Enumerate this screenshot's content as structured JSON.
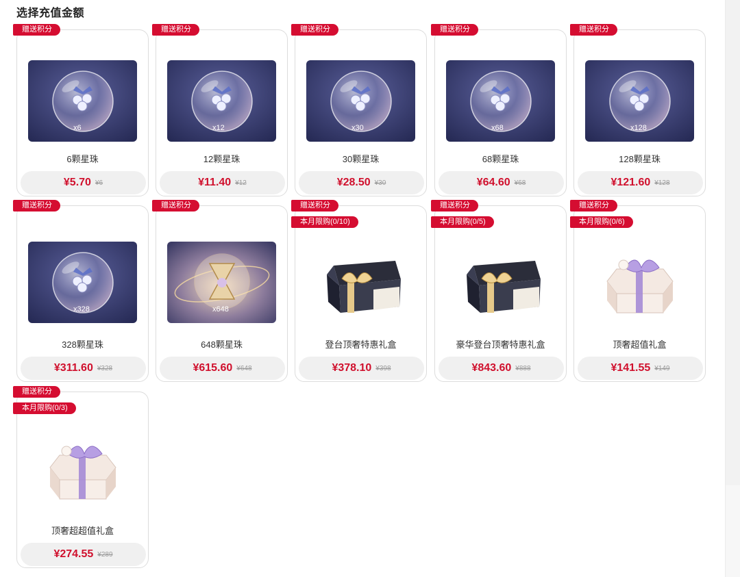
{
  "header": {
    "title": "选择充值金额"
  },
  "colors": {
    "accent": "#d50d31",
    "price": "#d0102d",
    "card_border": "#dcdcdc"
  },
  "products": [
    {
      "name": "6颗星珠",
      "price": "¥5.70",
      "original": "¥6",
      "bonus": "赠送积分",
      "limit": "",
      "image": "orb",
      "qty": "x6"
    },
    {
      "name": "12颗星珠",
      "price": "¥11.40",
      "original": "¥12",
      "bonus": "赠送积分",
      "limit": "",
      "image": "orb",
      "qty": "x12"
    },
    {
      "name": "30颗星珠",
      "price": "¥28.50",
      "original": "¥30",
      "bonus": "赠送积分",
      "limit": "",
      "image": "orb",
      "qty": "x30"
    },
    {
      "name": "68颗星珠",
      "price": "¥64.60",
      "original": "¥68",
      "bonus": "赠送积分",
      "limit": "",
      "image": "orb",
      "qty": "x68"
    },
    {
      "name": "128颗星珠",
      "price": "¥121.60",
      "original": "¥128",
      "bonus": "赠送积分",
      "limit": "",
      "image": "orb",
      "qty": "x128"
    },
    {
      "name": "328颗星珠",
      "price": "¥311.60",
      "original": "¥328",
      "bonus": "赠送积分",
      "limit": "",
      "image": "orb",
      "qty": "x328"
    },
    {
      "name": "648颗星珠",
      "price": "¥615.60",
      "original": "¥648",
      "bonus": "赠送积分",
      "limit": "",
      "image": "orb-gold",
      "qty": "x648"
    },
    {
      "name": "登台顶奢特惠礼盒",
      "price": "¥378.10",
      "original": "¥398",
      "bonus": "赠送积分",
      "limit": "本月限购(0/10)",
      "image": "black-box",
      "qty": ""
    },
    {
      "name": "豪华登台顶奢特惠礼盒",
      "price": "¥843.60",
      "original": "¥888",
      "bonus": "赠送积分",
      "limit": "本月限购(0/5)",
      "image": "black-box",
      "qty": ""
    },
    {
      "name": "顶奢超值礼盒",
      "price": "¥141.55",
      "original": "¥149",
      "bonus": "赠送积分",
      "limit": "本月限购(0/6)",
      "image": "white-box-small",
      "qty": ""
    },
    {
      "name": "顶奢超超值礼盒",
      "price": "¥274.55",
      "original": "¥289",
      "bonus": "赠送积分",
      "limit": "本月限购(0/3)",
      "image": "white-box",
      "qty": ""
    }
  ]
}
